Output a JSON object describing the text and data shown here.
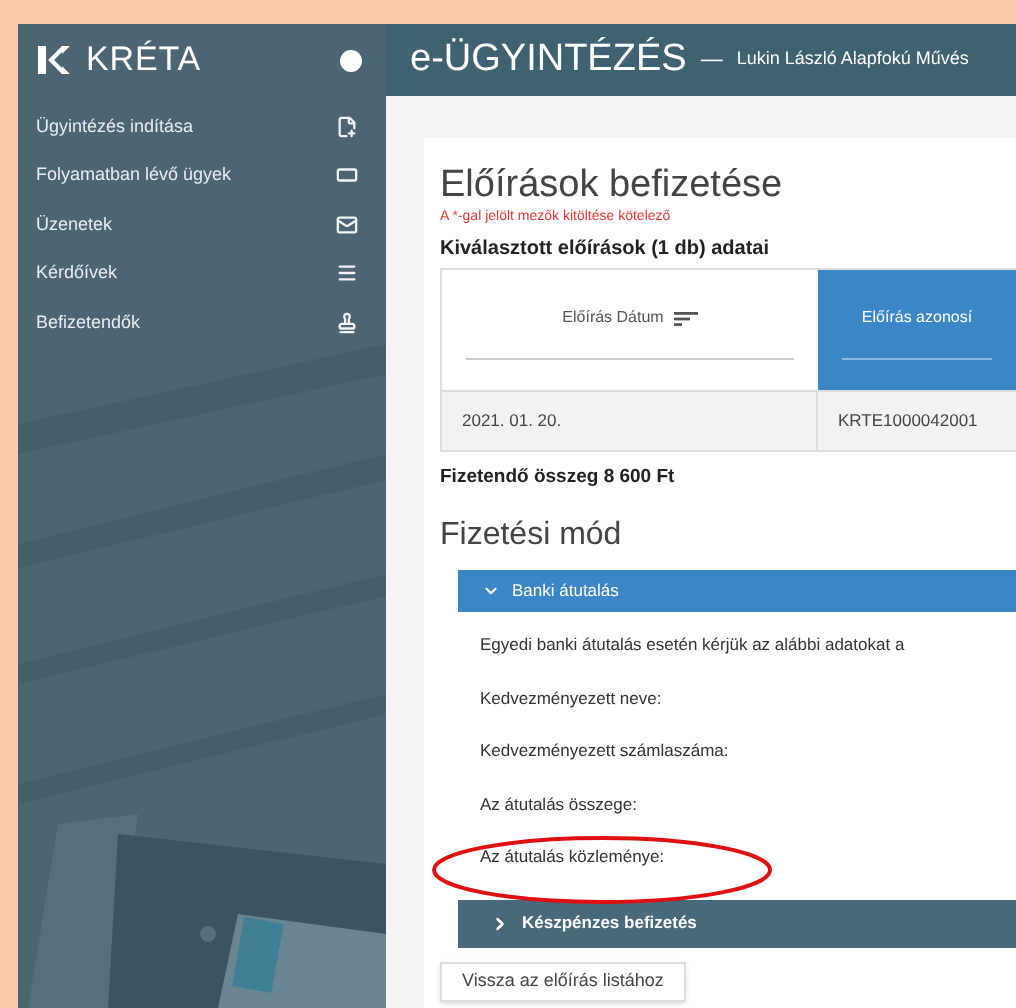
{
  "sidebar": {
    "brand": "KRÉTA",
    "items": [
      {
        "label": "Ügyintézés indítása"
      },
      {
        "label": "Folyamatban lévő ügyek"
      },
      {
        "label": "Üzenetek"
      },
      {
        "label": "Kérdőívek"
      },
      {
        "label": "Befizetendők"
      }
    ]
  },
  "header": {
    "title": "e-ÜGYINTÉZÉS",
    "separator": "—",
    "school": "Lukin László Alapfokú Művés"
  },
  "page": {
    "title": "Előírások befizetése",
    "required_note": "A *-gal jelölt mezők kitöltése kötelező",
    "selection_heading": "Kiválasztott előírások (1 db) adatai",
    "table": {
      "columns": [
        {
          "label": "Előírás Dátum",
          "selected": false
        },
        {
          "label": "Előírás azonosí",
          "selected": true
        }
      ],
      "rows": [
        [
          "2021. 01. 20.",
          "KRTE1000042001"
        ]
      ]
    },
    "total": "Fizetendő összeg 8 600 Ft",
    "payment_heading": "Fizetési mód",
    "accordions": [
      {
        "label": "Banki átutalás",
        "expanded": true,
        "lines": [
          "Egyedi banki átutalás esetén kérjük az alábbi adatokat a",
          "Kedvezményezett neve:",
          "Kedvezményezett számlaszáma:",
          "Az átutalás összege:",
          "Az átutalás közleménye:"
        ]
      },
      {
        "label": "Készpénzes befizetés",
        "expanded": false
      }
    ],
    "back_button": "Vissza az előírás listához"
  }
}
